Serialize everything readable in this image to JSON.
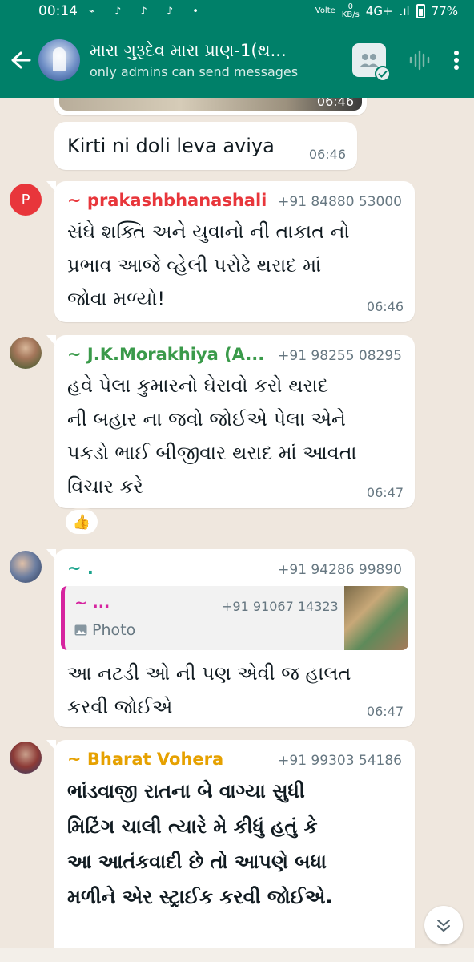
{
  "status_bar": {
    "time": "00:14",
    "network_label": "Volte",
    "net_speed": "0",
    "net_speed_unit": "KB/s",
    "net_type": "4G+",
    "battery": "77%"
  },
  "header": {
    "title": "મારા ગુરૂદેવ મારા પ્રાણ-1(થ...",
    "subtitle": "only admins can send messages"
  },
  "messages": [
    {
      "text": "Kirti ni doli leva aviya",
      "time": "06:46"
    },
    {
      "avatar_letter": "P",
      "sender": "~ prakashbhanashali",
      "sender_color": "#e8363b",
      "phone": "+91 84880 53000",
      "lines": [
        "સંઘે શક્તિ અને યુવાનો ની તાકાત નો",
        "પ્રભાવ આજે વ્હેલી પરોઢે થરાદ માં",
        "જોવા મળ્યો!"
      ],
      "time": "06:46"
    },
    {
      "sender": "~ J.K.Morakhiya (A...",
      "sender_color": "#3a9a4a",
      "phone": "+91 98255 08295",
      "lines": [
        "હવે પેલા કુમારનો ઘેરાવો કરો થરાદ",
        "ની બહાર ના જવો જોઈએ પેલા એને",
        "પકડો ભાઈ બીજીવાર થરાદ માં આવતા",
        "વિચાર કરે"
      ],
      "time": "06:47",
      "reaction": "👍"
    },
    {
      "sender": "~ .",
      "sender_color": "#1aa38c",
      "phone": "+91 94286 99890",
      "quote": {
        "name": "~ ...",
        "phone": "+91 91067 14323",
        "type": "Photo"
      },
      "lines": [
        "આ નટડી ઓ ની પણ એવી જ હાલત",
        "કરવી જોઈએ"
      ],
      "time": "06:47"
    },
    {
      "sender": "~ Bharat Vohera",
      "sender_color": "#e6a100",
      "phone": "+91 99303 54186",
      "lines": [
        "ભાંડવાજી રાતના બે વાગ્યા સુધી",
        "મિટિંગ ચાલી ત્યારે મે કીધું હતું કે",
        "આ આતંકવાદી છે તો આપણે બધા",
        "મળીને એર સ્ટ્રાઈક કરવી જોઈએ."
      ]
    }
  ],
  "image_bubble_time": "06:46"
}
